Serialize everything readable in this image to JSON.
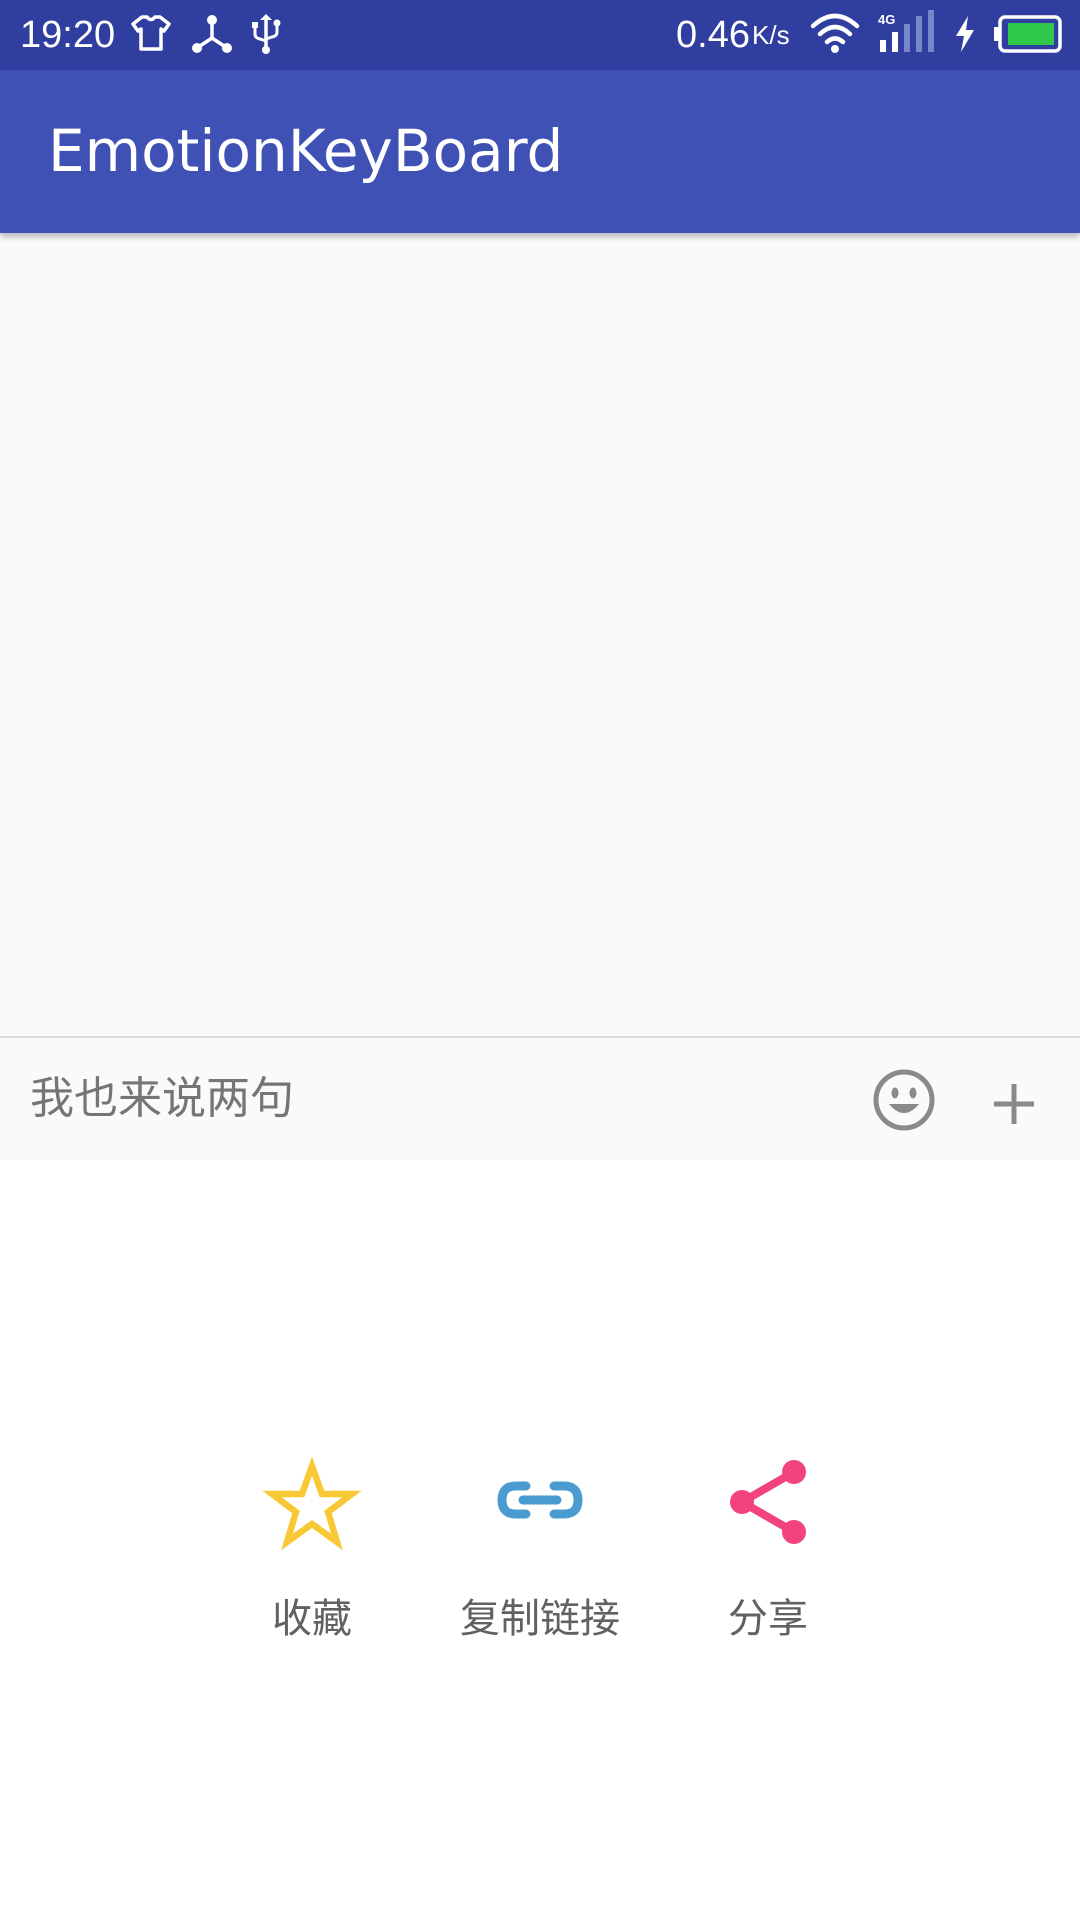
{
  "status_bar": {
    "time": "19:20",
    "speed": "0.46",
    "speed_unit": "K/s",
    "icons": [
      "tshirt-icon",
      "network-hub-icon",
      "usb-icon",
      "wifi-icon",
      "signal-4g-icon",
      "charging-icon",
      "battery-icon"
    ],
    "background": "#303f9f"
  },
  "toolbar": {
    "title": "EmotionKeyBoard",
    "background": "#3f51b5"
  },
  "input_bar": {
    "placeholder": "我也来说两句",
    "value": "",
    "icons": [
      "emoji-icon",
      "plus-icon"
    ]
  },
  "action_panel": {
    "items": [
      {
        "label": "收藏",
        "icon": "star-icon",
        "color": "#f9c935"
      },
      {
        "label": "复制链接",
        "icon": "link-icon",
        "color": "#4a9bd0"
      },
      {
        "label": "分享",
        "icon": "share-icon",
        "color": "#f2437d"
      }
    ]
  }
}
